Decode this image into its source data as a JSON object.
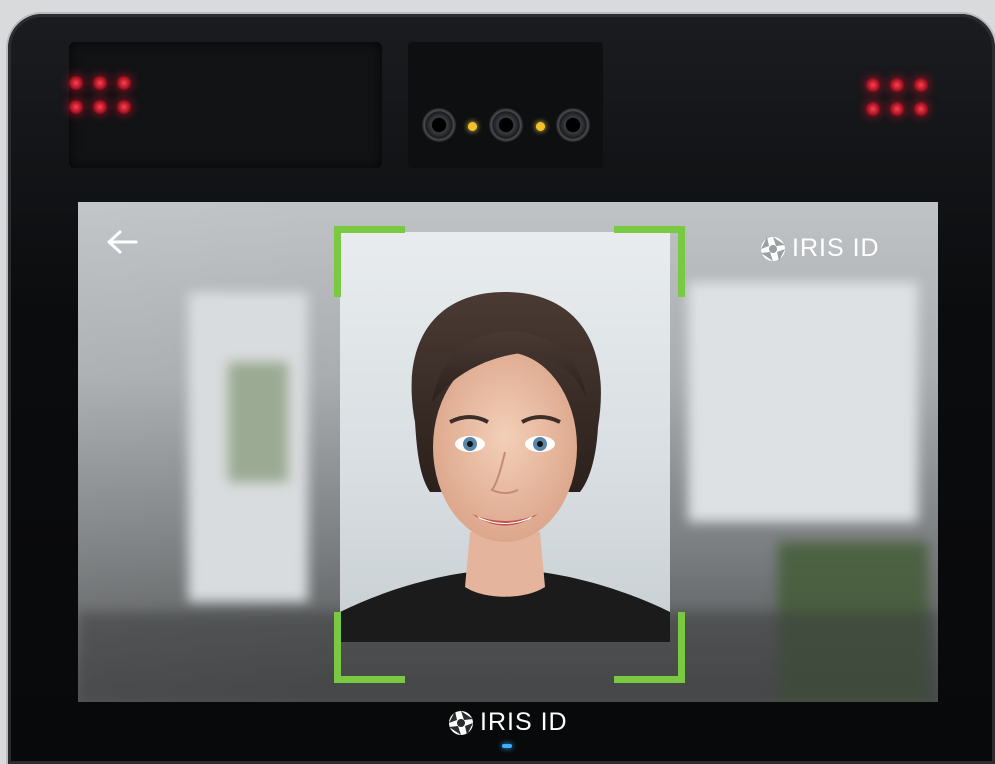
{
  "screen": {
    "back_icon": "arrow-left-icon",
    "brand": {
      "icon": "iris-shutter-icon",
      "text": "IRIS ID"
    }
  },
  "bezel": {
    "brand": {
      "icon": "iris-shutter-icon",
      "text": "IRIS ID"
    }
  },
  "face_frame": {
    "color": "#7ac943"
  }
}
